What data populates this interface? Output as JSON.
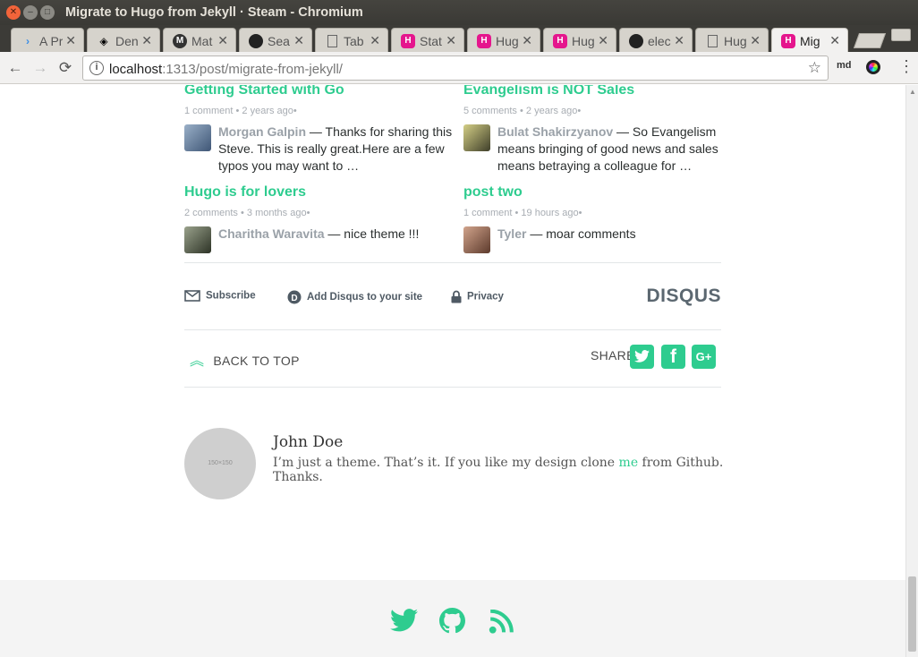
{
  "window": {
    "title": "Migrate to Hugo from Jekyll · Steam - Chromium",
    "close_glyph": "✕",
    "minimize_glyph": "–",
    "maximize_glyph": "□"
  },
  "tabs": [
    {
      "label": "A Pr",
      "icon": "tab-favicon-arrow",
      "active": false
    },
    {
      "label": "Den",
      "icon": "codepen-icon",
      "active": false
    },
    {
      "label": "Mat",
      "icon": "materialize-icon",
      "active": false
    },
    {
      "label": "Sea",
      "icon": "github-icon",
      "active": false
    },
    {
      "label": "Tab",
      "icon": "page-icon",
      "active": false
    },
    {
      "label": "Stat",
      "icon": "hugo-icon",
      "active": false
    },
    {
      "label": "Hug",
      "icon": "hugo-icon",
      "active": false
    },
    {
      "label": "Hug",
      "icon": "hugo-icon",
      "active": false
    },
    {
      "label": "elec",
      "icon": "github-icon",
      "active": false
    },
    {
      "label": "Hug",
      "icon": "page-icon",
      "active": false
    },
    {
      "label": "Mig",
      "icon": "hugo-icon",
      "active": true
    }
  ],
  "toolbar": {
    "back_glyph": "←",
    "forward_glyph": "→",
    "reload_glyph": "⟳",
    "url_host": "localhost",
    "url_path": ":1313/post/migrate-from-jekyll/",
    "info_glyph": "i",
    "star_glyph": "☆",
    "extension_label": "md",
    "menu_glyph": "⋮"
  },
  "recommendations": [
    {
      "title": "Getting Started with Go",
      "comments": "1 comment",
      "age": "2 years ago",
      "author": "Morgan Galpin",
      "text": " — Thanks for sharing this Steve. This is really great.Here are a few typos you may want to …",
      "avatar_color": "#6f87a8"
    },
    {
      "title": "Evangelism is NOT Sales",
      "comments": "5 comments",
      "age": "2 years ago",
      "author": "Bulat Shakirzyanov",
      "text": " — So Evangelism means bringing of good news and sales means betraying a colleague for …",
      "avatar_color": "#8a8a52"
    },
    {
      "title": "Hugo is for lovers",
      "comments": "2 comments",
      "age": "3 months ago",
      "author": "Charitha Waravita",
      "text": " — nice theme !!!",
      "avatar_color": "#6d7462"
    },
    {
      "title": "post two",
      "comments": "1 comment",
      "age": "19 hours ago",
      "author": "Tyler",
      "text": " — moar comments",
      "avatar_color": "#a27a6a"
    }
  ],
  "meta_separator": "•",
  "disqus": {
    "subscribe": "Subscribe",
    "add_disqus": "Add Disqus to your site",
    "privacy": "Privacy",
    "logo": "DISQUS"
  },
  "nav": {
    "back_to_top": "BACK TO TOP",
    "share": "SHARE"
  },
  "share_buttons": [
    {
      "name": "twitter",
      "glyph": "t"
    },
    {
      "name": "facebook",
      "glyph": "f"
    },
    {
      "name": "google-plus",
      "glyph": "G+"
    }
  ],
  "author": {
    "avatar_placeholder": "150×150",
    "name": "John Doe",
    "bio_before": "I’m just a theme. That’s it. If you like my design clone ",
    "bio_link": "me",
    "bio_after": " from Github. Thanks."
  },
  "colors": {
    "accent": "#2ecc8f",
    "footer_bg": "#f4f4f4"
  },
  "footer_icons": [
    "twitter-icon",
    "github-icon",
    "rss-icon"
  ]
}
